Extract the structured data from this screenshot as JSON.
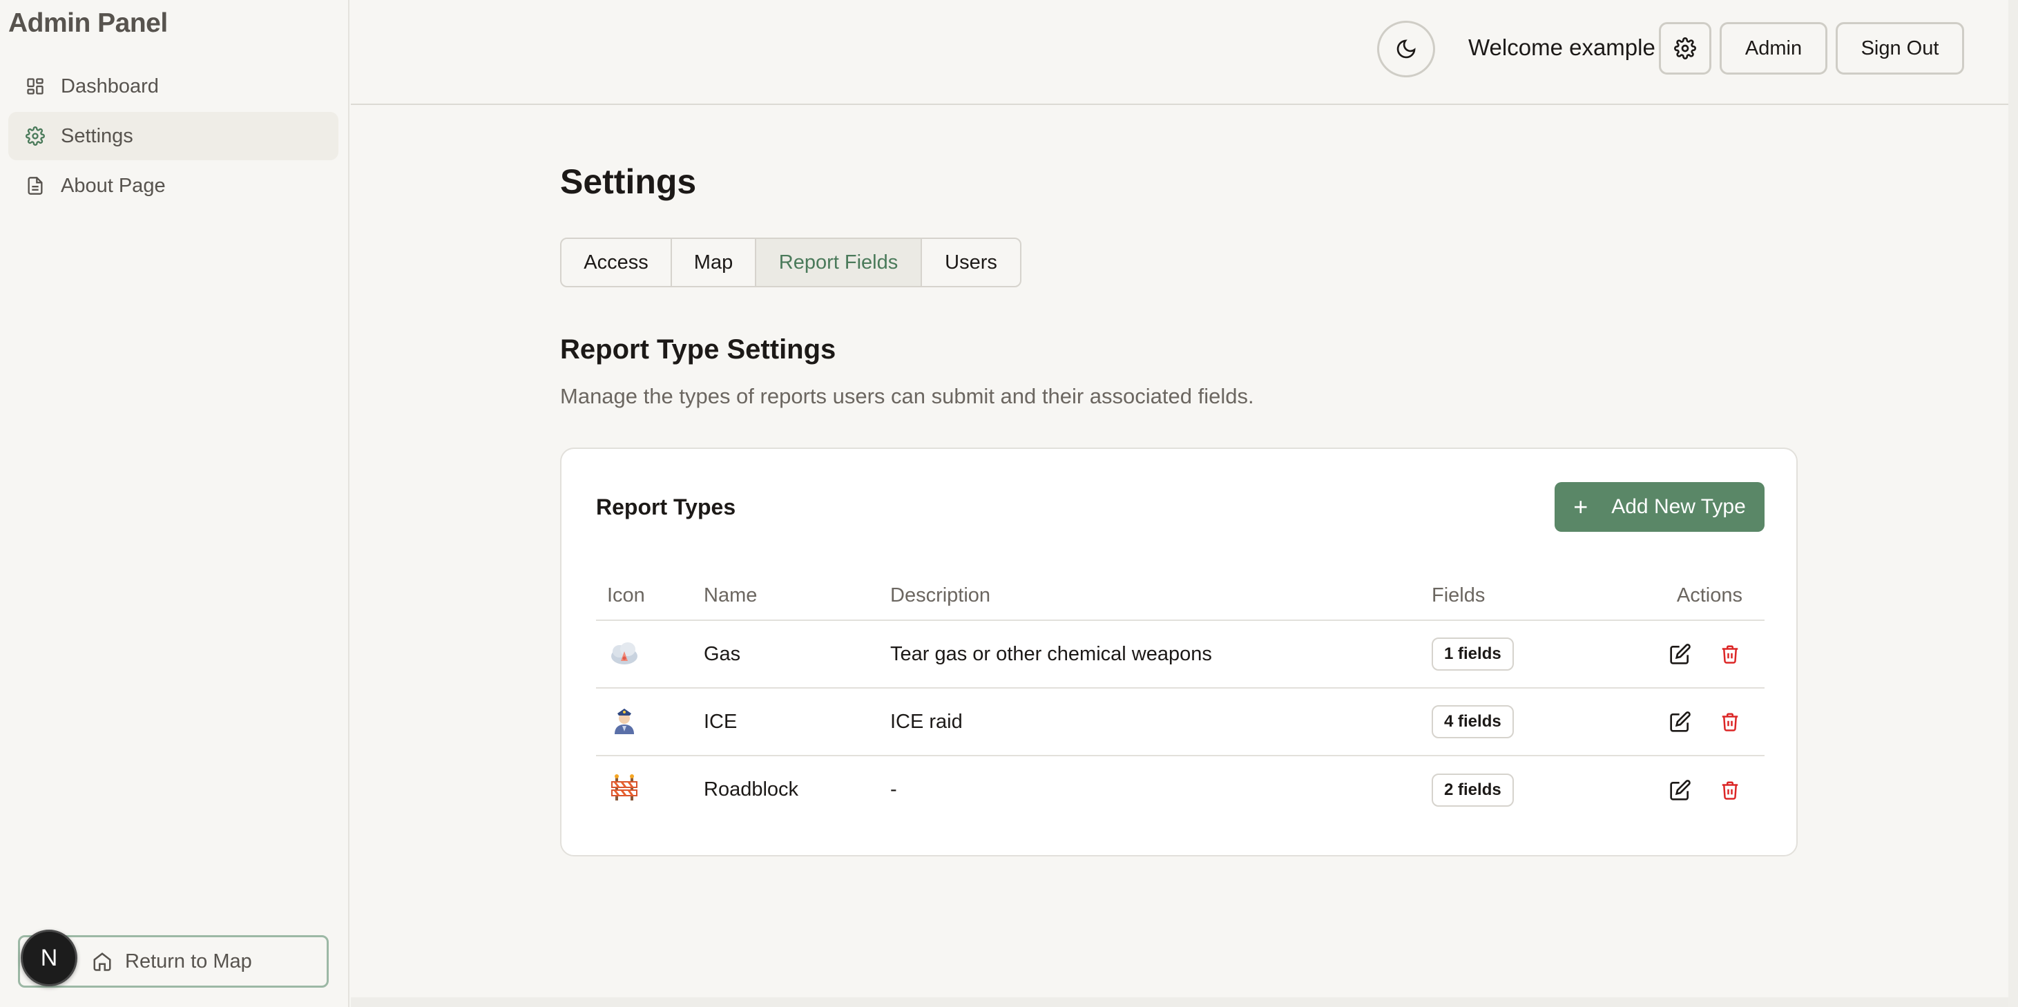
{
  "app": {
    "title": "Admin Panel"
  },
  "sidebar": {
    "items": [
      {
        "label": "Dashboard",
        "icon": "dashboard-icon"
      },
      {
        "label": "Settings",
        "icon": "gear-icon",
        "active": true
      },
      {
        "label": "About Page",
        "icon": "document-icon"
      }
    ],
    "return_label": "Return to Map",
    "avatar_letter": "N"
  },
  "header": {
    "welcome": "Welcome example",
    "admin_label": "Admin",
    "signout_label": "Sign Out"
  },
  "page": {
    "title": "Settings",
    "tabs": [
      {
        "label": "Access"
      },
      {
        "label": "Map"
      },
      {
        "label": "Report Fields",
        "active": true
      },
      {
        "label": "Users"
      }
    ],
    "section_title": "Report Type Settings",
    "section_desc": "Manage the types of reports users can submit and their associated fields."
  },
  "card": {
    "title": "Report Types",
    "add_label": "Add New Type",
    "columns": [
      "Icon",
      "Name",
      "Description",
      "Fields",
      "Actions"
    ],
    "rows": [
      {
        "icon": "gas-cloud-icon",
        "name": "Gas",
        "description": "Tear gas or other chemical weapons",
        "fields": "1 fields"
      },
      {
        "icon": "officer-icon",
        "name": "ICE",
        "description": "ICE raid",
        "fields": "4 fields"
      },
      {
        "icon": "roadblock-icon",
        "name": "Roadblock",
        "description": "-",
        "fields": "2 fields"
      }
    ]
  },
  "colors": {
    "accent": "#5a8767",
    "accent_text": "#4a7a5a",
    "danger": "#dc2626",
    "background": "#f7f6f3"
  }
}
